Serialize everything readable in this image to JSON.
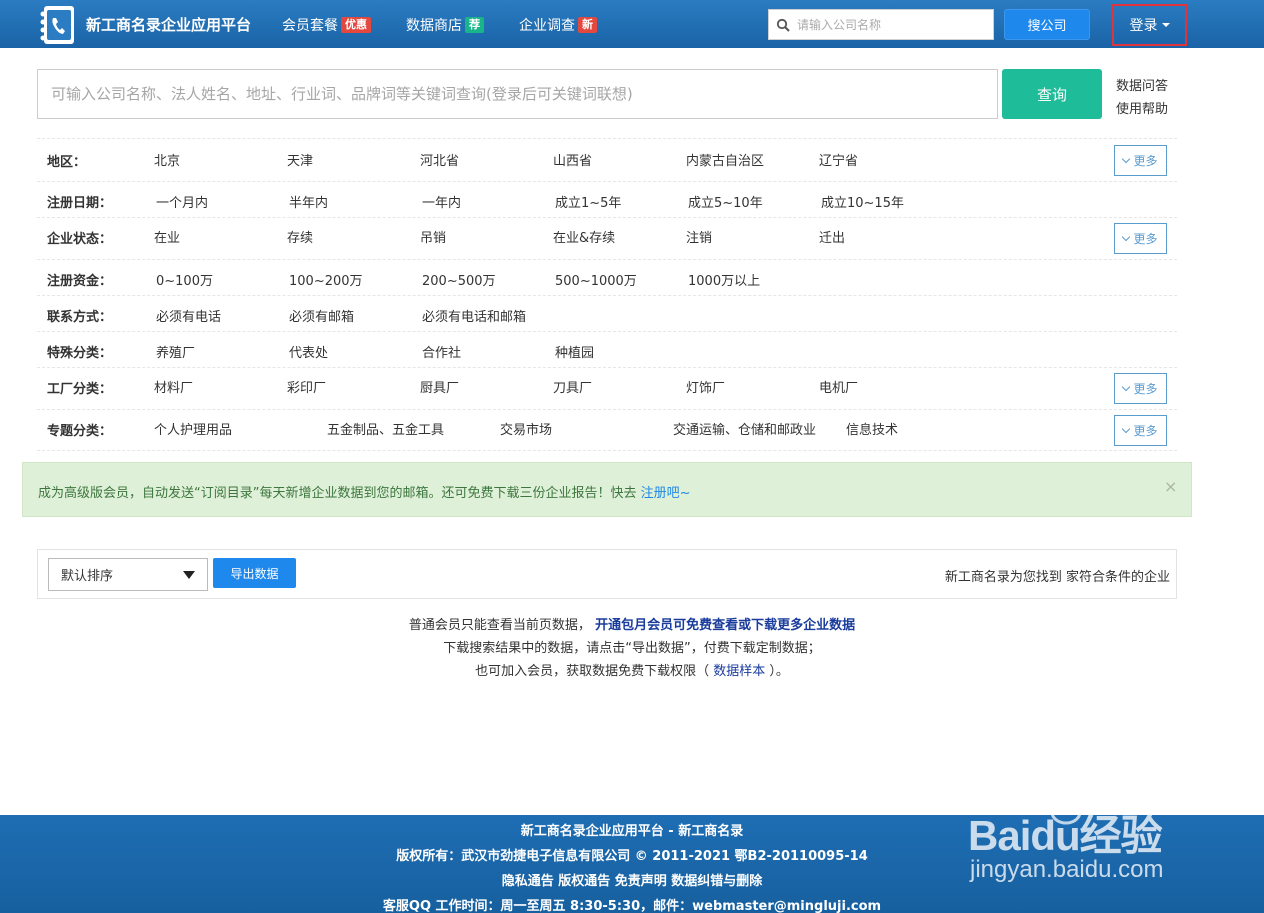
{
  "header": {
    "brand": "新工商名录企业应用平台",
    "nav": [
      {
        "label": "会员套餐",
        "badge": "优惠",
        "badge_color": "#e3483f"
      },
      {
        "label": "数据商店",
        "badge": "荐",
        "badge_color": "#19b48a"
      },
      {
        "label": "企业调查",
        "badge": "新",
        "badge_color": "#e3483f"
      }
    ],
    "search_placeholder": "请输入公司名称",
    "search_button": "搜公司",
    "login": "登录"
  },
  "main_search": {
    "placeholder": "可输入公司名称、法人姓名、地址、行业词、品牌词等关键词查询(登录后可关键词联想)",
    "button": "查询",
    "side_links": [
      "数据问答",
      "使用帮助"
    ]
  },
  "filters": {
    "more_label": "更多",
    "rows": [
      {
        "label": "地区：",
        "options": [
          "北京",
          "天津",
          "河北省",
          "山西省",
          "内蒙古自治区",
          "辽宁省"
        ],
        "more": true
      },
      {
        "label": "注册日期：",
        "options": [
          "一个月内",
          "半年内",
          "一年内",
          "成立1~5年",
          "成立5~10年",
          "成立10~15年"
        ],
        "more": false
      },
      {
        "label": "企业状态：",
        "options": [
          "在业",
          "存续",
          "吊销",
          "在业&存续",
          "注销",
          "迁出"
        ],
        "more": true
      },
      {
        "label": "注册资金：",
        "options": [
          "0~100万",
          "100~200万",
          "200~500万",
          "500~1000万",
          "1000万以上"
        ],
        "more": false
      },
      {
        "label": "联系方式：",
        "options": [
          "必须有电话",
          "必须有邮箱",
          "必须有电话和邮箱"
        ],
        "more": false
      },
      {
        "label": "特殊分类：",
        "options": [
          "养殖厂",
          "代表处",
          "合作社",
          "种植园"
        ],
        "more": false
      },
      {
        "label": "工厂分类：",
        "options": [
          "材料厂",
          "彩印厂",
          "厨具厂",
          "刀具厂",
          "灯饰厂",
          "电机厂"
        ],
        "more": true
      },
      {
        "label": "专题分类：",
        "options": [
          "个人护理用品",
          "五金制品、五金工具",
          "交易市场",
          "交通运输、仓储和邮政业",
          "信息技术"
        ],
        "more": true
      }
    ]
  },
  "alert": {
    "text": "成为高级版会员，自动发送“订阅目录”每天新增企业数据到您的邮箱。还可免费下载三份企业报告！快去",
    "link": "注册吧~",
    "close": "×"
  },
  "results": {
    "sort_value": "默认排序",
    "export_button": "导出数据",
    "summary": "新工商名录为您找到 家符合条件的企业"
  },
  "notices": {
    "line1_text": "普通会员只能查看当前页数据，",
    "line1_link": "开通包月会员可免费查看或下载更多企业数据",
    "line2": "下载搜索结果中的数据，请点击“导出数据”，付费下载定制数据；",
    "line3_text": "也可加入会员，获取数据免费下载权限（",
    "line3_link": "数据样本",
    "line3_end": "）。"
  },
  "footer": {
    "line1": "新工商名录企业应用平台 - 新工商名录",
    "line2": "版权所有：武汉市劲捷电子信息有限公司 © 2011-2021 鄂B2-20110095-14",
    "line3": "隐私通告 版权通告 免责声明 数据纠错与删除",
    "line4": "客服QQ  工作时间：周一至周五 8:30-5:30，邮件：webmaster@mingluji.com"
  },
  "watermark": {
    "line1": "Baidu经验",
    "line2": "jingyan.baidu.com"
  }
}
